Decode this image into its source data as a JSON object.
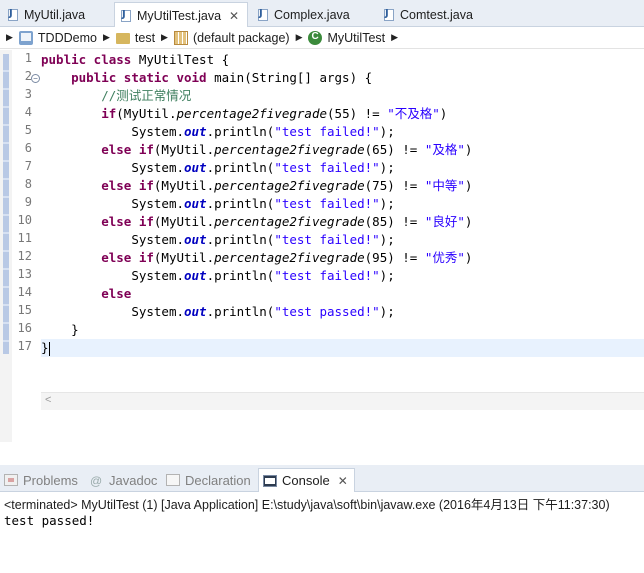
{
  "tabs": [
    {
      "label": "MyUtil.java",
      "active": false
    },
    {
      "label": "MyUtilTest.java",
      "active": true
    },
    {
      "label": "Complex.java",
      "active": false
    },
    {
      "label": "Comtest.java",
      "active": false
    }
  ],
  "close_glyph": "✕",
  "breadcrumb": {
    "project": "TDDDemo",
    "folder": "test",
    "package": "(default package)",
    "class": "MyUtilTest"
  },
  "line_numbers": [
    "1",
    "2",
    "3",
    "4",
    "5",
    "6",
    "7",
    "8",
    "9",
    "10",
    "11",
    "12",
    "13",
    "14",
    "15",
    "16",
    "17"
  ],
  "code": {
    "l1": {
      "kw": "public class ",
      "rest": "MyUtilTest {"
    },
    "l2": {
      "kw": "public static void ",
      "rest": "main(String[] args) {"
    },
    "l3": {
      "comment": "//测试正常情况"
    },
    "l4": {
      "kw": "if",
      "pre": "(MyUtil.",
      "method": "percentage2fivegrade",
      "mid": "(55) != ",
      "str": "\"不及格\"",
      "post": ")"
    },
    "l5": {
      "pre": "System.",
      "field": "out",
      "mid": ".println(",
      "str": "\"test failed!\"",
      "post": ");"
    },
    "l6": {
      "kw": "else if",
      "pre": "(MyUtil.",
      "method": "percentage2fivegrade",
      "mid": "(65) != ",
      "str": "\"及格\"",
      "post": ")"
    },
    "l7": {
      "pre": "System.",
      "field": "out",
      "mid": ".println(",
      "str": "\"test failed!\"",
      "post": ");"
    },
    "l8": {
      "kw": "else if",
      "pre": "(MyUtil.",
      "method": "percentage2fivegrade",
      "mid": "(75) != ",
      "str": "\"中等\"",
      "post": ")"
    },
    "l9": {
      "pre": "System.",
      "field": "out",
      "mid": ".println(",
      "str": "\"test failed!\"",
      "post": ");"
    },
    "l10": {
      "kw": "else if",
      "pre": "(MyUtil.",
      "method": "percentage2fivegrade",
      "mid": "(85) != ",
      "str": "\"良好\"",
      "post": ")"
    },
    "l11": {
      "pre": "System.",
      "field": "out",
      "mid": ".println(",
      "str": "\"test failed!\"",
      "post": ");"
    },
    "l12": {
      "kw": "else if",
      "pre": "(MyUtil.",
      "method": "percentage2fivegrade",
      "mid": "(95) != ",
      "str": "\"优秀\"",
      "post": ")"
    },
    "l13": {
      "pre": "System.",
      "field": "out",
      "mid": ".println(",
      "str": "\"test failed!\"",
      "post": ");"
    },
    "l14": {
      "kw": "else"
    },
    "l15": {
      "pre": "System.",
      "field": "out",
      "mid": ".println(",
      "str": "\"test passed!\"",
      "post": ");"
    },
    "l16": {
      "text": "}"
    },
    "l17": {
      "text": "}"
    }
  },
  "views": [
    {
      "label": "Problems",
      "active": false
    },
    {
      "label": "Javadoc",
      "active": false
    },
    {
      "label": "Declaration",
      "active": false
    },
    {
      "label": "Console",
      "active": true
    }
  ],
  "console": {
    "header": "<terminated> MyUtilTest (1) [Java Application] E:\\study\\java\\soft\\bin\\javaw.exe (2016年4月13日 下午11:37:30)",
    "output": "test passed!"
  },
  "javadoc_glyph": "@"
}
